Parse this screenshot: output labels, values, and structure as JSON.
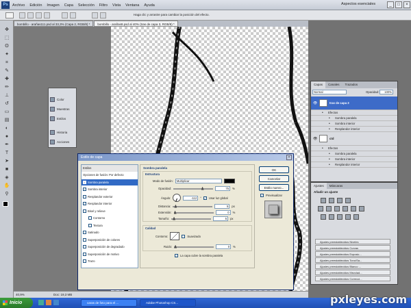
{
  "menubar": {
    "items": [
      "Archivo",
      "Edición",
      "Imagen",
      "Capa",
      "Selección",
      "Filtro",
      "Vista",
      "Ventana",
      "Ayuda"
    ],
    "workspace": "Aspectos esenciales",
    "ps_logo": "Ps"
  },
  "optbar": {
    "hint": "Haga clic y arrastre para cambiar la posición del efecto."
  },
  "tabs": [
    "bombillo - arañas111.psd al 33,3% (Capa 2, RGB/8) *",
    "bombillo - arañas8.psd al 40% (tras de capa 3, RGB/8) *"
  ],
  "status": {
    "zoom": "40,9%",
    "doc": "Doc: 19,3 MB"
  },
  "minipanel": [
    "Color",
    "Muestras",
    "Estilos",
    "Historia",
    "Acciones"
  ],
  "dialog": {
    "title": "Estilo de capa",
    "left_header": "Estilos",
    "styles": [
      {
        "label": "Opciones de fusión: Por defecto",
        "checkbox": false,
        "checked": false,
        "indent": 0
      },
      {
        "label": "Sombra paralela",
        "checkbox": true,
        "checked": true,
        "indent": 0,
        "selected": true
      },
      {
        "label": "Sombra interior",
        "checkbox": true,
        "checked": true,
        "indent": 0
      },
      {
        "label": "Resplandor exterior",
        "checkbox": true,
        "checked": false,
        "indent": 0
      },
      {
        "label": "Resplandor interior",
        "checkbox": true,
        "checked": true,
        "indent": 0
      },
      {
        "label": "Bisel y relieve",
        "checkbox": true,
        "checked": false,
        "indent": 0
      },
      {
        "label": "Contorno",
        "checkbox": true,
        "checked": false,
        "indent": 1
      },
      {
        "label": "Textura",
        "checkbox": true,
        "checked": false,
        "indent": 1
      },
      {
        "label": "Satinado",
        "checkbox": true,
        "checked": false,
        "indent": 0
      },
      {
        "label": "Superposición de colores",
        "checkbox": true,
        "checked": false,
        "indent": 0
      },
      {
        "label": "Superposición de degradado",
        "checkbox": true,
        "checked": false,
        "indent": 0
      },
      {
        "label": "Superposición de motivo",
        "checkbox": true,
        "checked": false,
        "indent": 0
      },
      {
        "label": "Trazo",
        "checkbox": true,
        "checked": false,
        "indent": 0
      }
    ],
    "section_title": "Sombra paralela",
    "structure_title": "Estructura",
    "blend_label": "Modo de fusión:",
    "blend_value": "Multiplicar",
    "blend_color": "#000000",
    "opacity_label": "Opacidad:",
    "opacity_value": "75",
    "opacity_pct": 0.75,
    "angle_label": "Ángulo:",
    "angle_value": "-112",
    "angle_unit": "°",
    "global_light_label": "Usar luz global",
    "global_light": true,
    "distance_label": "Distancia:",
    "distance_value": "5",
    "distance_unit": "px",
    "spread_label": "Extensión:",
    "spread_value": "0",
    "spread_unit": "%",
    "size_label": "Tamaño:",
    "size_value": "5",
    "size_unit": "px",
    "quality_title": "Calidad",
    "contour_label": "Contorno:",
    "antialias_label": "Suavizado",
    "noise_label": "Ruido:",
    "noise_value": "0",
    "noise_unit": "%",
    "knockout_label": "La capa cubre la sombra paralela",
    "pct": "%",
    "ok": "OK",
    "cancel": "Cancelar",
    "new_style": "Estilo nuevo...",
    "preview": "Previsualizar"
  },
  "layers": {
    "tabs": [
      "Capas",
      "Canales",
      "Trazados"
    ],
    "blend": "Normal",
    "opacity_label": "Opacidad:",
    "opacity": "100%",
    "rows": [
      {
        "name": "tras de capa 3",
        "type": "layer",
        "selected": true
      },
      {
        "name": "Efectos",
        "type": "fx"
      },
      {
        "name": "Sombra paralela",
        "type": "effect"
      },
      {
        "name": "Sombra interior",
        "type": "effect"
      },
      {
        "name": "Resplandor interior",
        "type": "effect"
      },
      {
        "name": "ctd",
        "type": "layer"
      },
      {
        "name": "Efectos",
        "type": "fx"
      },
      {
        "name": "Sombra paralela",
        "type": "effect"
      },
      {
        "name": "Sombra interior",
        "type": "effect"
      },
      {
        "name": "Resplandor interior",
        "type": "effect"
      }
    ]
  },
  "adjust": {
    "tabs": [
      "Ajustes",
      "Máscaras"
    ],
    "title": "Añadir un ajuste",
    "presets": [
      "Ajustes preestablecidos Niveles",
      "Ajustes preestablecidos Curvas",
      "Ajustes preestablecidos Exposic...",
      "Ajustes preestablecidos Tono/Sa...",
      "Ajustes preestablecidos Blanco ...",
      "Ajustes preestablecidos Mezclad...",
      "Ajustes preestablecidos Correcci..."
    ]
  },
  "taskbar": {
    "start": "Inicio",
    "tasks": [
      "caras de foto para el ...",
      "Adobe Photoshop CS..."
    ],
    "watermark": "pxleyes.com"
  }
}
